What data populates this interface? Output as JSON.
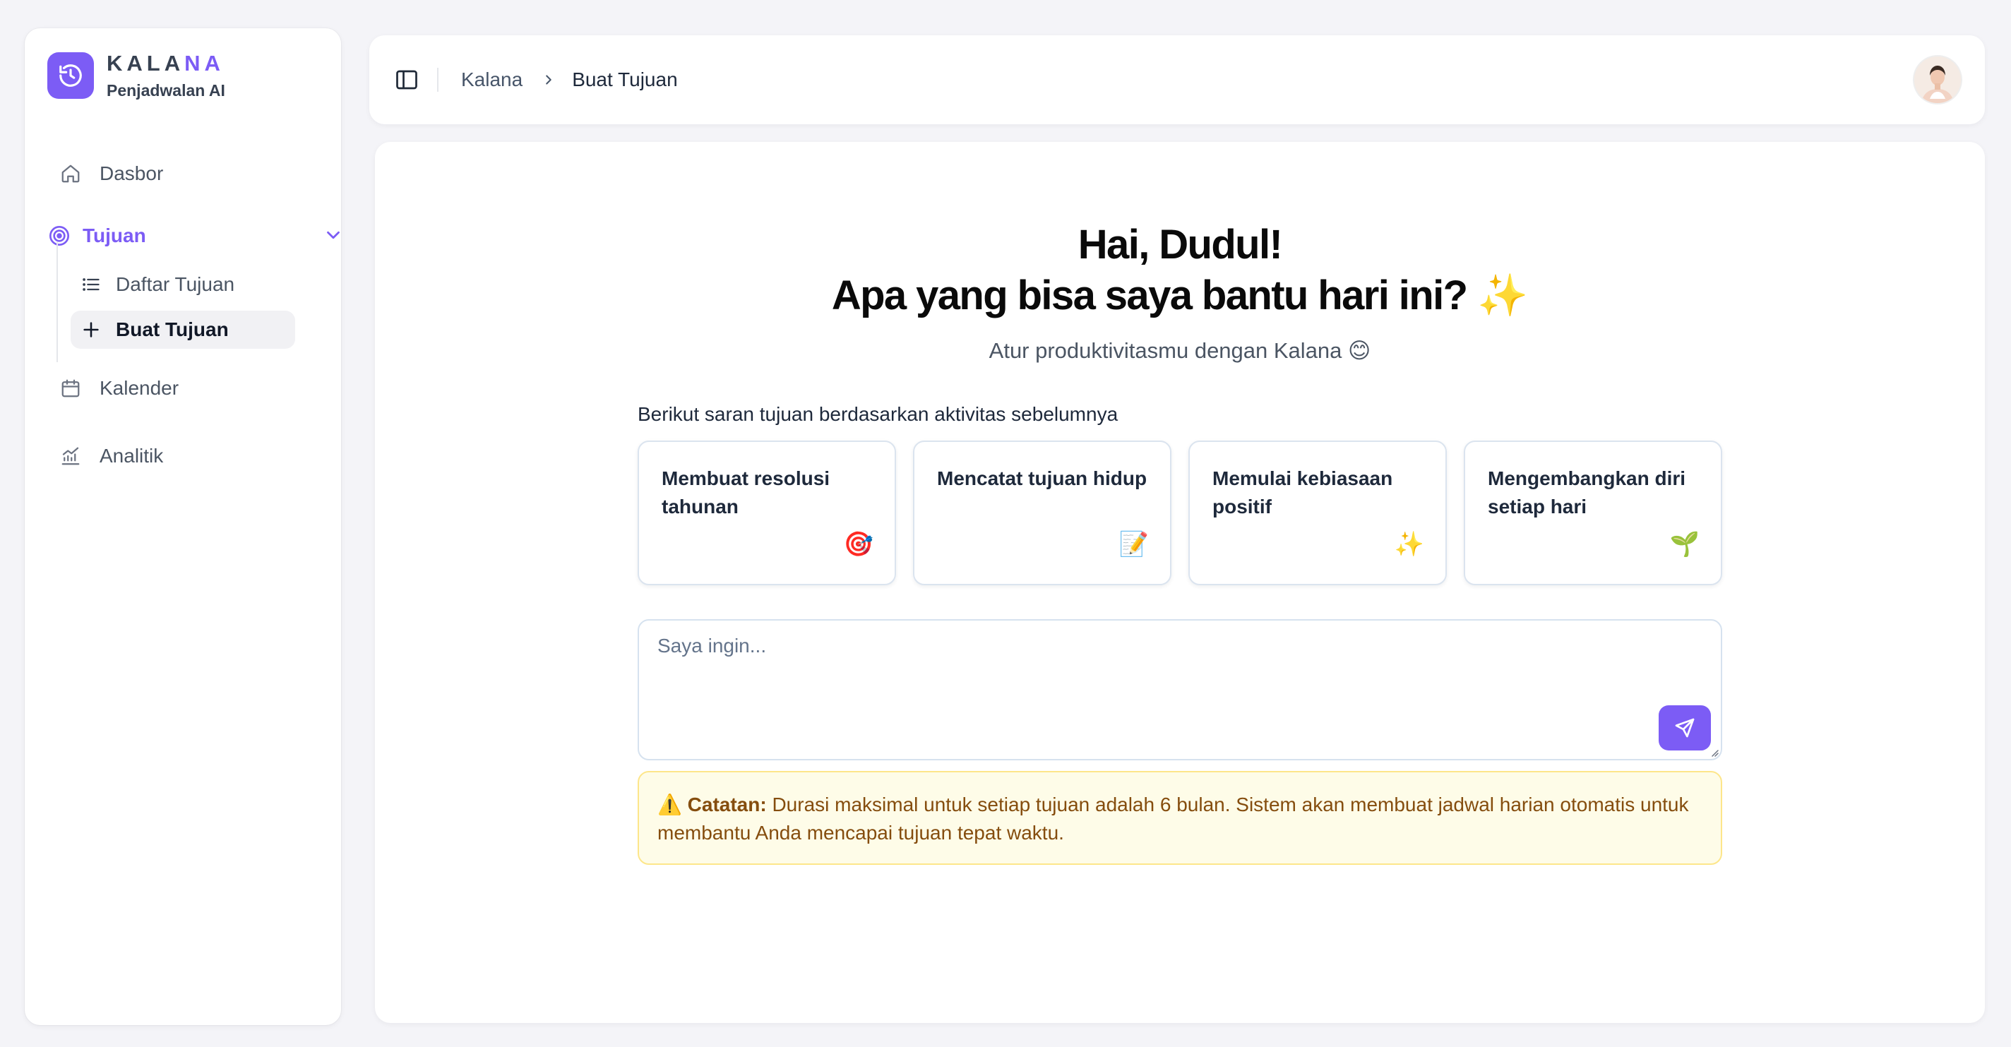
{
  "sidebar": {
    "brand": {
      "name_main": "KALA",
      "name_accent": "NA",
      "subtitle": "Penjadwalan AI"
    },
    "items": {
      "dashboard": "Dasbor",
      "goals": "Tujuan",
      "goal_list": "Daftar Tujuan",
      "create_goal": "Buat Tujuan",
      "calendar": "Kalender",
      "analytics": "Analitik"
    }
  },
  "header": {
    "breadcrumb_root": "Kalana",
    "breadcrumb_separator": "›",
    "breadcrumb_current": "Buat Tujuan"
  },
  "main": {
    "greeting_line1": "Hai, Dudul!",
    "greeting_line2": "Apa yang bisa saya bantu hari ini?",
    "greeting_emoji": "✨",
    "subtitle": "Atur produktivitasmu dengan Kalana 😊",
    "suggestions_label": "Berikut saran tujuan berdasarkan aktivitas sebelumnya",
    "suggestions": [
      {
        "title": "Membuat resolusi tahunan",
        "emoji": "🎯"
      },
      {
        "title": "Mencatat tujuan hidup",
        "emoji": "📝"
      },
      {
        "title": "Memulai kebiasaan positif",
        "emoji": "✨"
      },
      {
        "title": "Mengembangkan diri setiap hari",
        "emoji": "🌱"
      }
    ],
    "input_placeholder": "Saya ingin...",
    "note_icon": "⚠️",
    "note_label": "Catatan:",
    "note_text": "Durasi maksimal untuk setiap tujuan adalah 6 bulan. Sistem akan membuat jadwal harian otomatis untuk membantu Anda mencapai tujuan tepat waktu."
  },
  "colors": {
    "accent": "#7c5cf5",
    "page_bg": "#f4f4f8",
    "note_bg": "#fefce8",
    "note_border": "#fde68a",
    "note_text": "#854d0e"
  },
  "icons": {
    "brand": "clock-history-icon",
    "dashboard": "home-icon",
    "goals": "target-icon",
    "goals_toggle": "chevron-down-icon",
    "goal_list": "list-icon",
    "create_goal": "plus-icon",
    "calendar": "calendar-icon",
    "analytics": "chart-line-icon",
    "sidebar_toggle": "panel-left-icon",
    "send": "send-icon"
  }
}
